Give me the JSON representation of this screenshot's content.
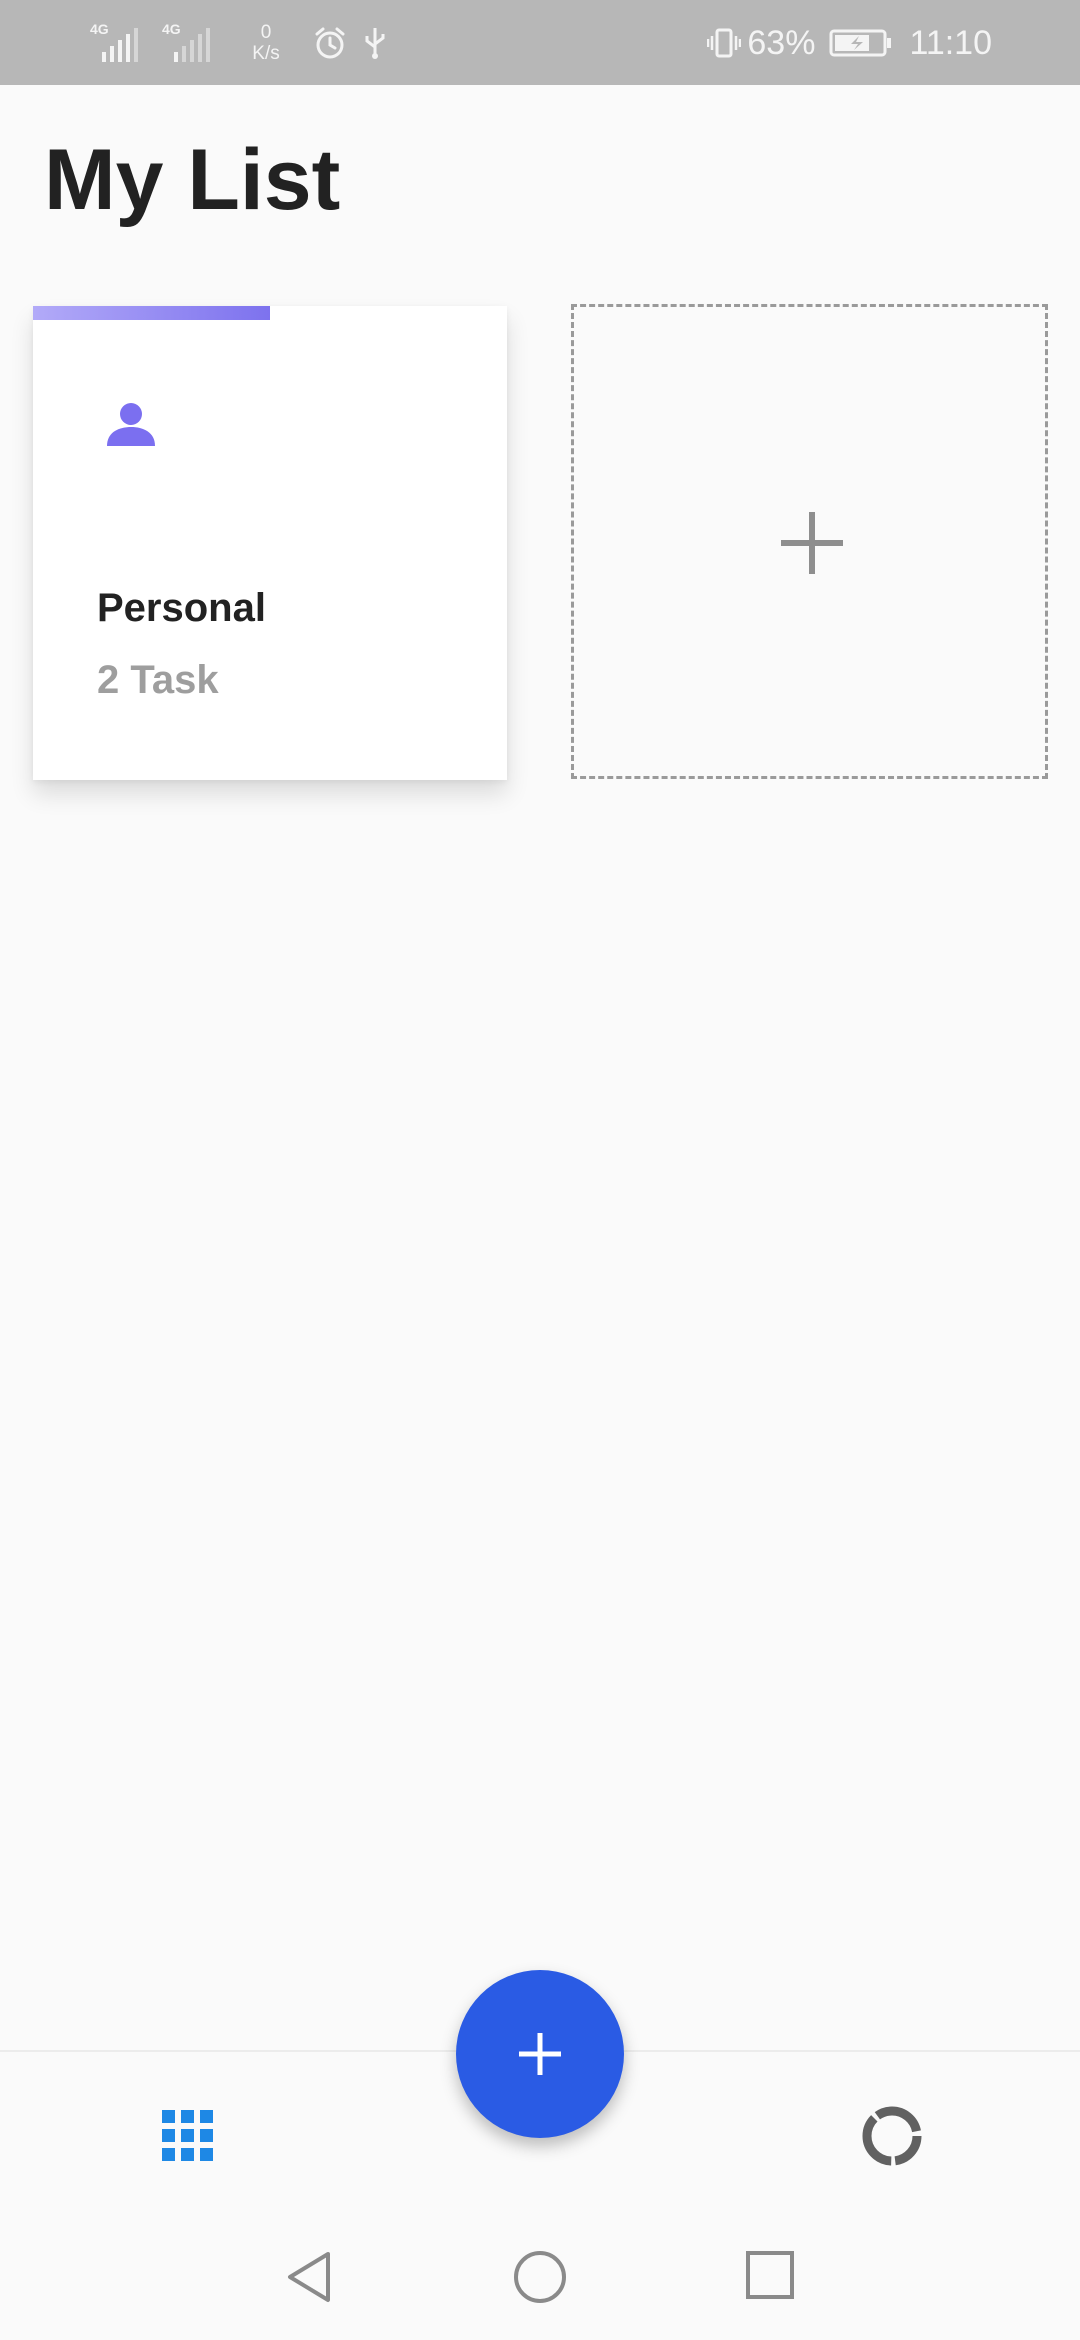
{
  "status_bar": {
    "network_1": "4G",
    "network_2": "4G",
    "speed_value": "0",
    "speed_unit": "K/s",
    "battery_percent": "63%",
    "time": "11:10"
  },
  "header": {
    "title": "My List"
  },
  "lists": [
    {
      "name": "Personal",
      "task_count": "2 Task",
      "icon": "person-icon",
      "progress": 0.5,
      "accent_color": "#7b6ff0"
    }
  ],
  "add_list": {
    "icon": "plus-icon"
  },
  "fab": {
    "icon": "plus-icon",
    "color": "#2a5be4"
  },
  "bottom_nav": {
    "items": [
      {
        "icon": "grid-icon",
        "active": true,
        "color": "#1e88e5"
      },
      {
        "icon": "donut-chart-icon",
        "active": false,
        "color": "#616161"
      }
    ]
  },
  "system_nav": {
    "buttons": [
      "back-icon",
      "home-icon",
      "recents-icon"
    ]
  }
}
